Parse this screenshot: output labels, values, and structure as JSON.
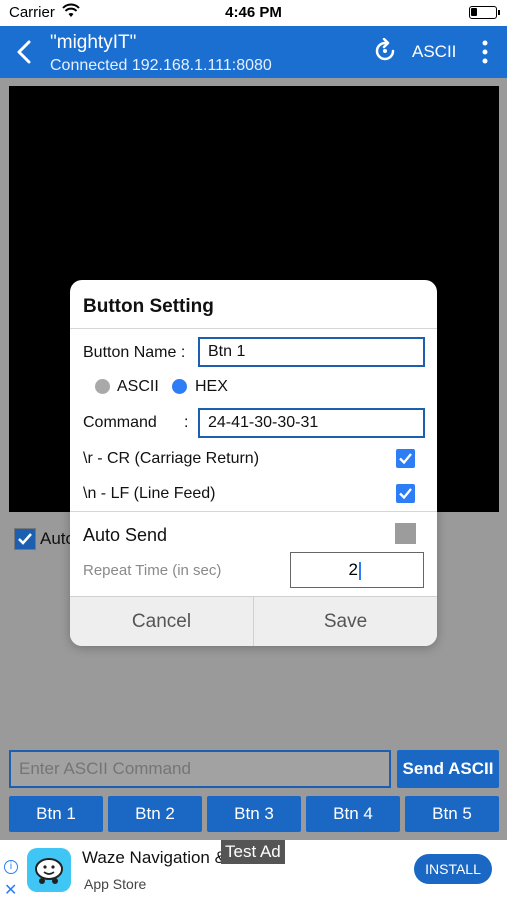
{
  "status_bar": {
    "carrier": "Carrier",
    "time": "4:46 PM"
  },
  "nav": {
    "title": "\"mightyIT\"",
    "subtitle": "Connected 192.168.1.111:8080",
    "mode": "ASCII",
    "color": "#1a6fd0"
  },
  "main": {
    "autoscroll_label": "Auto",
    "command_placeholder": "Enter ASCII Command",
    "send_label": "Send ASCII",
    "buttons": [
      "Btn 1",
      "Btn 2",
      "Btn 3",
      "Btn 4",
      "Btn 5"
    ]
  },
  "dialog": {
    "title": "Button Setting",
    "button_name_label": "Button Name :",
    "button_name_value": "Btn 1",
    "ascii_label": "ASCII",
    "hex_label": "HEX",
    "selected_format": "HEX",
    "command_label": "Command",
    "command_colon": ":",
    "command_value": "24-41-30-30-31",
    "cr_label": "\\r - CR (Carriage Return)",
    "cr_checked": true,
    "lf_label": "\\n - LF (Line Feed)",
    "lf_checked": true,
    "auto_send_label": "Auto Send",
    "auto_send_checked": false,
    "repeat_label": "Repeat Time (in sec)",
    "repeat_value": "2",
    "cancel_label": "Cancel",
    "save_label": "Save"
  },
  "ad": {
    "app_name": "Waze Navigation & Traffic",
    "store": "App Store",
    "install_label": "INSTALL",
    "badge": "Test Ad",
    "info_glyph": "i",
    "close_glyph": "✕"
  }
}
